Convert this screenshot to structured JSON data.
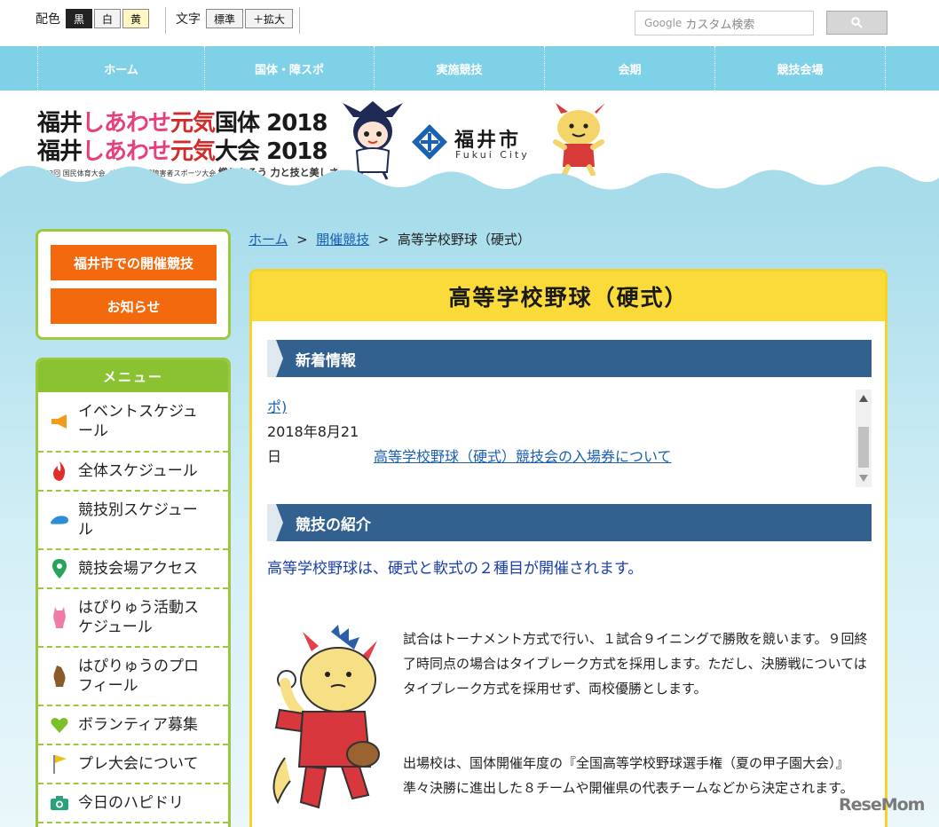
{
  "util": {
    "color_label": "配色",
    "color_options": [
      "黒",
      "白",
      "黄"
    ],
    "text_label": "文字",
    "size_options": [
      "標準",
      "＋拡大"
    ],
    "search_placeholder": "カスタム検索",
    "search_brand": "Google"
  },
  "nav": [
    "ホーム",
    "国体・障スポ",
    "実施競技",
    "会期",
    "競技会場"
  ],
  "banner": {
    "line1": {
      "a": "福井",
      "b": "しあわせ",
      "c": "元気",
      "d": "国体",
      "year": "2018"
    },
    "line2": {
      "a": "福井",
      "b": "しあわせ",
      "c": "元気",
      "d": "大会",
      "year": "2018"
    },
    "sub_small": "第73回 国民体育大会／第18回 全国障害者スポーツ大会",
    "sub_slogan": "織りなそう 力と技と美しさ",
    "city_name": "福井市",
    "city_en": "Fukui City"
  },
  "sidebar": {
    "buttons": [
      "福井市での開催競技",
      "お知らせ"
    ],
    "menu_title": "メニュー",
    "menu_items": [
      {
        "label_line1": "イベントスケジュ",
        "label_line2": "ール",
        "icon": "megaphone-icon",
        "color": "#f39a1e"
      },
      {
        "label_line1": "全体スケジュール",
        "label_line2": "",
        "icon": "flame-icon",
        "color": "#e22b2b"
      },
      {
        "label_line1": "競技別スケジュー",
        "label_line2": "ル",
        "icon": "shoe-icon",
        "color": "#2b8fd6"
      },
      {
        "label_line1": "競技会場アクセス",
        "label_line2": "",
        "icon": "map-pin-icon",
        "color": "#2aa35a"
      },
      {
        "label_line1": "はぴりゅう活動ス",
        "label_line2": "ケジュール",
        "icon": "mascot-pink-icon",
        "color": "#f07aa8"
      },
      {
        "label_line1": "はぴりゅうのプロ",
        "label_line2": "フィール",
        "icon": "mascot-brown-icon",
        "color": "#8a5a2a"
      },
      {
        "label_line1": "ボランティア募集",
        "label_line2": "",
        "icon": "heart-icon",
        "color": "#7bbf2a"
      },
      {
        "label_line1": "プレ大会について",
        "label_line2": "",
        "icon": "flag-icon",
        "color": "#e9c21e"
      },
      {
        "label_line1": "今日のハピドリ",
        "label_line2": "",
        "icon": "camera-icon",
        "color": "#2aa37a"
      }
    ]
  },
  "breadcrumb": {
    "home": "ホーム",
    "sep": ">",
    "parent": "開催競技",
    "current": "高等学校野球（硬式）"
  },
  "content": {
    "title": "高等学校野球（硬式）",
    "news_heading": "新着情報",
    "news_partial_link": "ポ)",
    "news_date_line1": "2018年8月21",
    "news_date_line2": "日",
    "news_link": "高等学校野球（硬式）競技会の入場券について",
    "intro_heading": "競技の紹介",
    "intro_lead": "高等学校野球は、硬式と軟式の２種目が開催されます。",
    "para1": "試合はトーナメント方式で行い、１試合９イニングで勝敗を競います。９回終了時同点の場合はタイブレーク方式を採用します。ただし、決勝戦についてはタイブレーク方式を採用せず、両校優勝とします。",
    "para2": "出場校は、国体開催年度の『全国高等学校野球選手権（夏の甲子園大会）』準々決勝に進出した８チームや開催県の代表チームなどから決定されます。"
  },
  "watermark": "ReseMom"
}
